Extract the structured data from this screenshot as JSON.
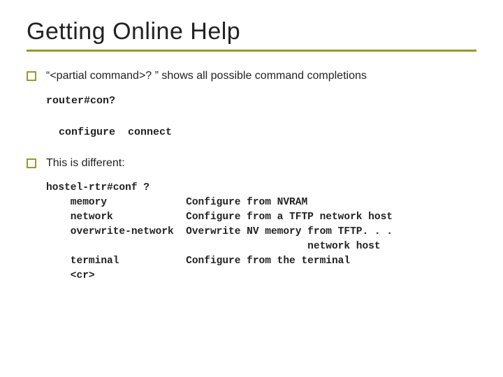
{
  "title": "Getting Online Help",
  "bullet1": "“<partial command>? ” shows all possible command completions",
  "code1": "router#con?\n\n  configure  connect",
  "bullet2": "This is different:",
  "code2": "hostel-rtr#conf ?\n    memory             Configure from NVRAM\n    network            Configure from a TFTP network host\n    overwrite-network  Overwrite NV memory from TFTP. . .\n                                           network host\n    terminal           Configure from the terminal\n    <cr>"
}
